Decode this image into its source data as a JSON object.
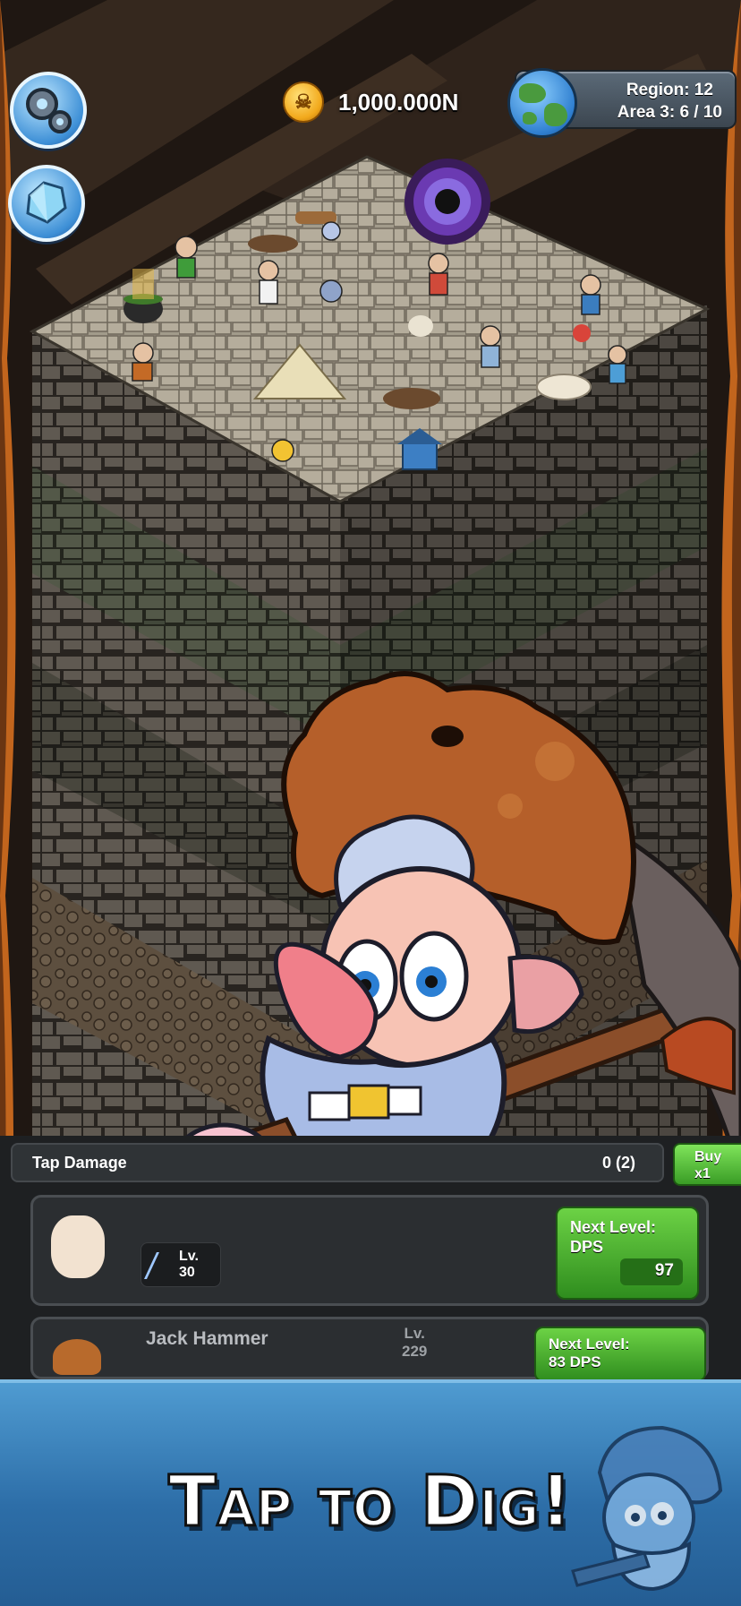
{
  "hud": {
    "coins": "1,000.000N",
    "coin_icon": "skull-coin-icon",
    "region_label": "Region: 12",
    "area_label": "Area 3: 6 / 10",
    "settings_icon": "gear-icon",
    "gems_icon": "gem-icon"
  },
  "panel": {
    "tap_damage_label": "Tap Damage",
    "tap_damage_count": "0 (2)",
    "buy_label_1": "Buy",
    "buy_label_2": "x1",
    "hero1": {
      "level_prefix": "Lv.",
      "level_value": "30",
      "next_level_line1": "Next Level:",
      "next_level_line2": "DPS",
      "cost": "97"
    },
    "hero2": {
      "name": "Jack Hammer",
      "level_line1": "Lv.",
      "level_line2": "229",
      "next_level_line1": "Next Level:",
      "next_level_line2": "83 DPS"
    }
  },
  "banner": {
    "title": "Tap to Dig!"
  },
  "colors": {
    "banner": "#3a82bd",
    "button_green": "#4cb232",
    "rock": "#5d574f",
    "dirt_wall": "#3a2b20"
  }
}
